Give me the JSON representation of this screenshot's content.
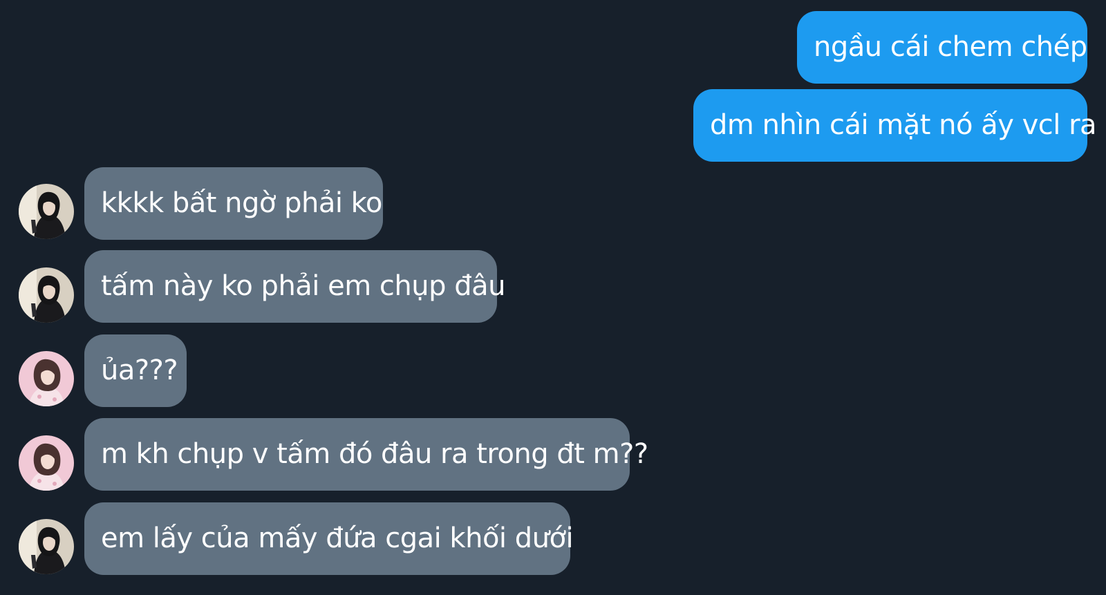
{
  "messages": [
    {
      "direction": "outgoing",
      "text": "ngầu cái chem chép"
    },
    {
      "direction": "outgoing",
      "text": "dm nhìn cái mặt nó ấy vcl ra"
    },
    {
      "direction": "incoming",
      "sender": "user-a",
      "text": "kkkk bất ngờ phải ko"
    },
    {
      "direction": "incoming",
      "sender": "user-a",
      "text": "tấm này ko phải em chụp đâu"
    },
    {
      "direction": "incoming",
      "sender": "user-b",
      "text": "ủa???"
    },
    {
      "direction": "incoming",
      "sender": "user-b",
      "text": "m kh chụp v tấm đó đâu ra trong đt m??"
    },
    {
      "direction": "incoming",
      "sender": "user-a",
      "text": "em lấy của mấy đứa cgai khối dưới"
    }
  ],
  "colors": {
    "background": "#17202b",
    "outgoing_bubble": "#1d9bf0",
    "incoming_bubble": "#617282",
    "text": "#ffffff"
  },
  "avatars": {
    "user-a": {
      "icon": "dark-profile-photo"
    },
    "user-b": {
      "icon": "pink-profile-photo"
    }
  }
}
